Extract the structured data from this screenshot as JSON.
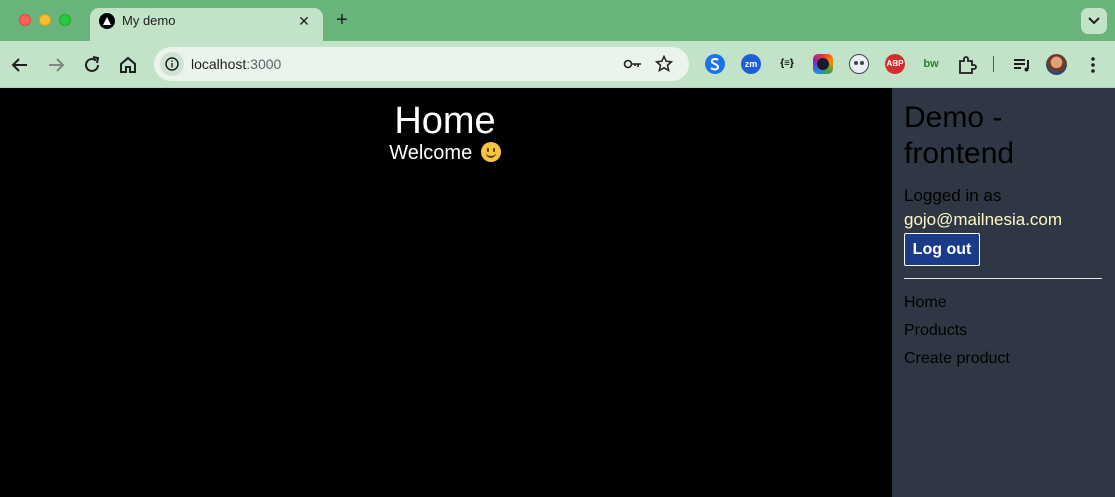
{
  "browser": {
    "tab": {
      "title": "My demo",
      "close_glyph": "✕"
    },
    "new_tab_glyph": "+",
    "address": {
      "host": "localhost",
      "port": ":3000"
    },
    "extensions": [
      {
        "name": "extension-s-icon",
        "label": "",
        "color": "#1a73e8"
      },
      {
        "name": "extension-zm-icon",
        "label": "zm",
        "color": "#1f5fd6"
      },
      {
        "name": "extension-json-icon",
        "label": "{≡}",
        "color": "#000000"
      },
      {
        "name": "extension-ring-icon",
        "label": "",
        "color": "#6a1b9a"
      },
      {
        "name": "extension-face-icon",
        "label": "",
        "color": "#37474f"
      },
      {
        "name": "extension-abp-icon",
        "label": "ABP",
        "color": "#d32f2f"
      },
      {
        "name": "extension-bw-icon",
        "label": "bw",
        "color": "#2e7d32"
      }
    ]
  },
  "main": {
    "title": "Home",
    "welcome": "Welcome"
  },
  "sidebar": {
    "title": "Demo - frontend",
    "logged_in_label": "Logged in as",
    "email": "gojo@mailnesia.com",
    "logout_label": "Log out",
    "nav": [
      {
        "label": "Home"
      },
      {
        "label": "Products"
      },
      {
        "label": "Create product"
      }
    ]
  }
}
